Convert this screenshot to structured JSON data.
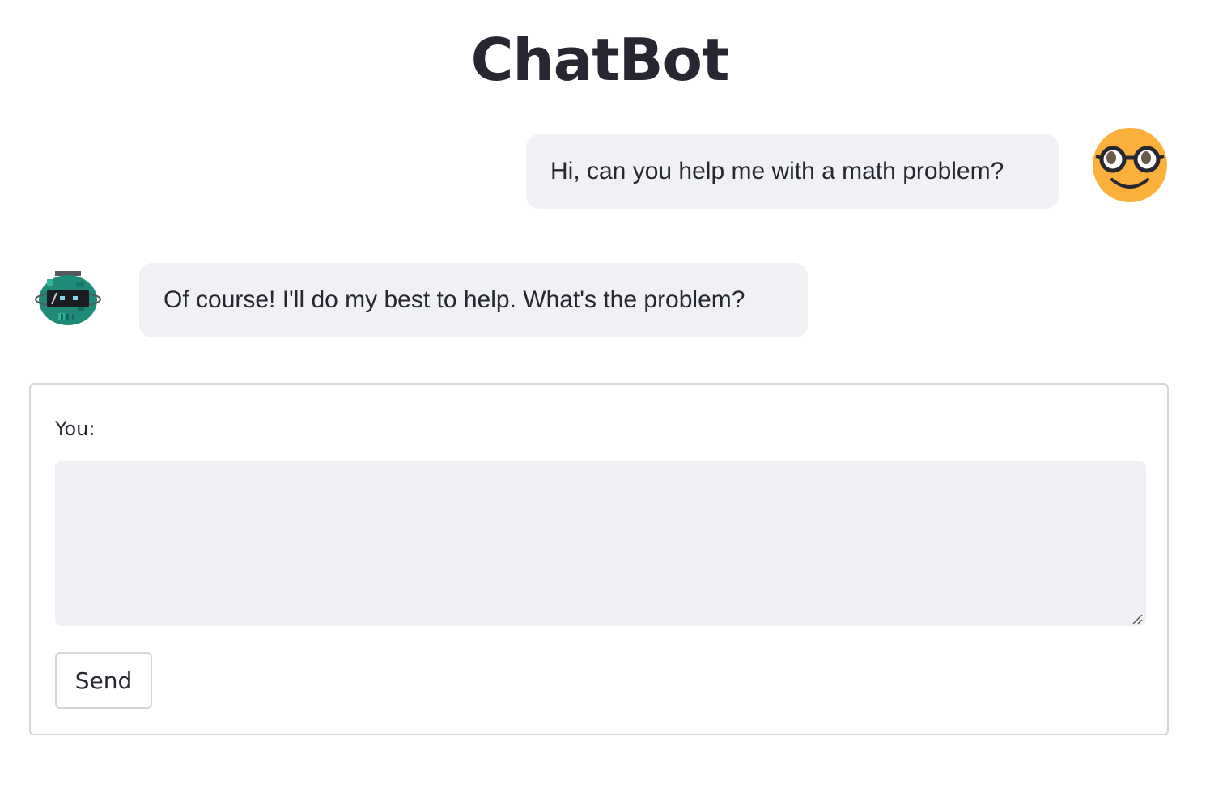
{
  "header": {
    "title": "ChatBot"
  },
  "messages": [
    {
      "role": "user",
      "text": "Hi, can you help me with a math problem?",
      "avatar_icon": "nerd-face-icon"
    },
    {
      "role": "bot",
      "text": "Of course! I'll do my best to help. What's the problem?",
      "avatar_icon": "robot-icon"
    }
  ],
  "form": {
    "label": "You:",
    "input_value": "",
    "send_label": "Send"
  },
  "colors": {
    "bubble_bg": "#eff1f5",
    "textarea_bg": "#eef0f4",
    "user_avatar": "#fbb03b",
    "bot_avatar": "#1f8a78",
    "text": "#262730",
    "border": "#d6d6d9"
  }
}
